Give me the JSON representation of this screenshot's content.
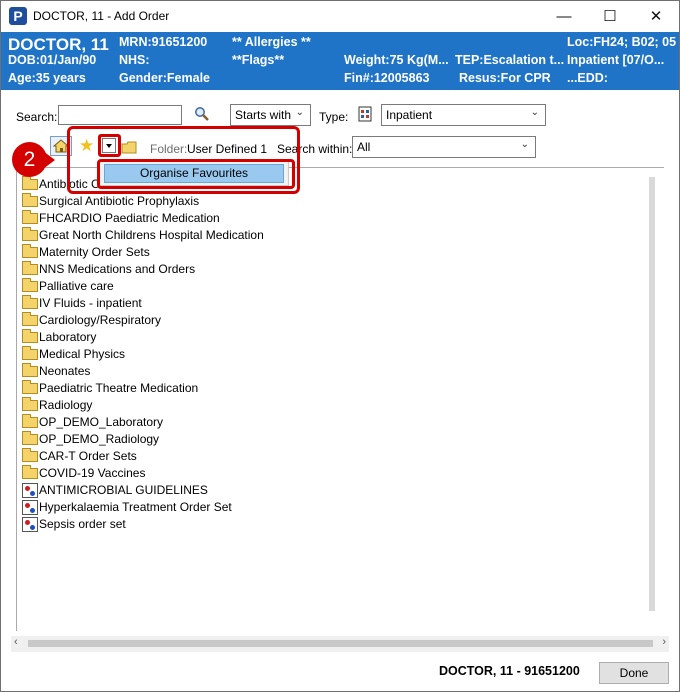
{
  "window": {
    "title": "DOCTOR, 11  - Add Order",
    "app_icon_letter": "P",
    "controls": {
      "minimize": "—",
      "maximize": "☐",
      "close": "✕"
    }
  },
  "banner": {
    "name": "DOCTOR, 11",
    "mrn": "MRN:91651200",
    "allergies": "** Allergies **",
    "loc": "Loc:FH24; B02; 05",
    "dob": "DOB:01/Jan/90",
    "nhs": "NHS:",
    "flags": "**Flags**",
    "weight": "Weight:75 Kg(M...",
    "tep": "TEP:Escalation t...",
    "encounter": "Inpatient [07/O...",
    "age": "Age:35 years",
    "gender": "Gender:Female",
    "fin": "Fin#:12005863",
    "resus": "Resus:For CPR",
    "edd": "...EDD:"
  },
  "search": {
    "label": "Search:",
    "value": "",
    "match_mode": "Starts with",
    "type_label": "Type:",
    "type_value": "Inpatient"
  },
  "toolbar": {
    "folder_label": "Folder:",
    "folder_value": "User Defined 1",
    "search_within_label": "Search within:",
    "search_within_value": "All"
  },
  "dropdown_menu": {
    "items": [
      "Organise Favourites"
    ]
  },
  "callout": {
    "number": "2"
  },
  "tree": {
    "items": [
      {
        "label": "Antibiotic C",
        "kind": "folder"
      },
      {
        "label": "Surgical Antibiotic Prophylaxis",
        "kind": "folder"
      },
      {
        "label": "FHCARDIO Paediatric Medication",
        "kind": "folder"
      },
      {
        "label": "Great North Childrens Hospital Medication",
        "kind": "folder"
      },
      {
        "label": "Maternity Order Sets",
        "kind": "folder"
      },
      {
        "label": "NNS Medications and Orders",
        "kind": "folder"
      },
      {
        "label": "Palliative care",
        "kind": "folder"
      },
      {
        "label": "IV Fluids - inpatient",
        "kind": "folder"
      },
      {
        "label": "Cardiology/Respiratory",
        "kind": "folder"
      },
      {
        "label": "Laboratory",
        "kind": "folder"
      },
      {
        "label": "Medical Physics",
        "kind": "folder"
      },
      {
        "label": "Neonates",
        "kind": "folder"
      },
      {
        "label": "Paediatric Theatre Medication",
        "kind": "folder"
      },
      {
        "label": "Radiology",
        "kind": "folder"
      },
      {
        "label": "OP_DEMO_Laboratory",
        "kind": "folder"
      },
      {
        "label": "OP_DEMO_Radiology",
        "kind": "folder"
      },
      {
        "label": "CAR-T Order Sets",
        "kind": "folder"
      },
      {
        "label": "COVID-19 Vaccines",
        "kind": "folder"
      },
      {
        "label": "ANTIMICROBIAL GUIDELINES",
        "kind": "orderset"
      },
      {
        "label": "Hyperkalaemia Treatment Order Set",
        "kind": "orderset"
      },
      {
        "label": "Sepsis order set",
        "kind": "orderset"
      }
    ]
  },
  "footer": {
    "patient": "DOCTOR, 11  - 91651200",
    "done_label": "Done"
  },
  "colors": {
    "banner": "#1f74c8",
    "highlight": "#d40000",
    "menu_selected": "#99c9ef"
  }
}
